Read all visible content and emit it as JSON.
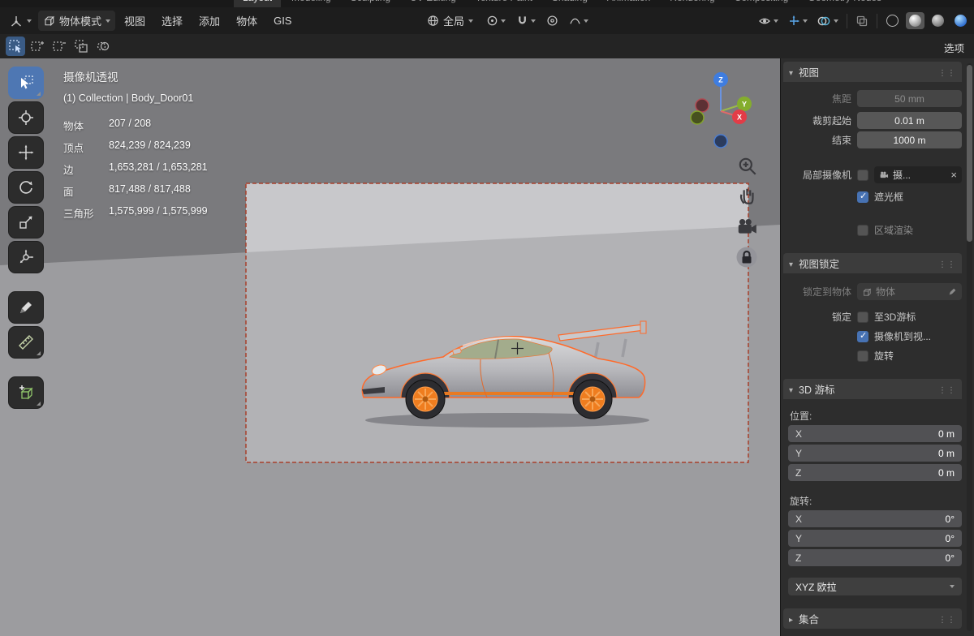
{
  "workspace_tabs": [
    "Layout",
    "Modeling",
    "Sculpting",
    "UV Editing",
    "Texture Paint",
    "Shading",
    "Animation",
    "Rendering",
    "Compositing",
    "Geometry Nodes"
  ],
  "menubar": {
    "mode_label": "物体模式",
    "menus": [
      "视图",
      "选择",
      "添加",
      "物体",
      "GIS"
    ],
    "orientation_label": "全局",
    "options_label": "选项"
  },
  "viewport": {
    "projection_label": "摄像机透视",
    "breadcrumb": "(1) Collection | Body_Door01",
    "stats": [
      {
        "label": "物体",
        "value": "207 / 208"
      },
      {
        "label": "顶点",
        "value": "824,239 / 824,239"
      },
      {
        "label": "边",
        "value": "1,653,281 / 1,653,281"
      },
      {
        "label": "面",
        "value": "817,488 / 817,488"
      },
      {
        "label": "三角形",
        "value": "1,575,999 / 1,575,999"
      }
    ],
    "gizmo": {
      "x": "X",
      "y": "Y",
      "z": "Z"
    }
  },
  "sidebar": {
    "view": {
      "title": "视图",
      "focal": {
        "label": "焦距",
        "value": "50 mm"
      },
      "clip_start": {
        "label": "裁剪起始",
        "value": "0.01 m"
      },
      "clip_end": {
        "label": "结束",
        "value": "1000 m"
      },
      "local_camera": {
        "label": "局部摄像机",
        "value": "摄..."
      },
      "passepartout_label": "遮光框",
      "render_region_label": "区域渲染"
    },
    "view_lock": {
      "title": "视图锁定",
      "lock_to_object": {
        "label": "锁定到物体",
        "value": "物体"
      },
      "lock_label": "锁定",
      "to_3d_cursor": "至3D游标",
      "camera_to_view": "摄像机到视...",
      "rotation": "旋转"
    },
    "cursor3d": {
      "title": "3D 游标",
      "location_label": "位置:",
      "rotation_label": "旋转:",
      "location": [
        {
          "axis": "X",
          "value": "0 m"
        },
        {
          "axis": "Y",
          "value": "0 m"
        },
        {
          "axis": "Z",
          "value": "0 m"
        }
      ],
      "rotation": [
        {
          "axis": "X",
          "value": "0°"
        },
        {
          "axis": "Y",
          "value": "0°"
        },
        {
          "axis": "Z",
          "value": "0°"
        }
      ],
      "rotation_mode": "XYZ 欧拉"
    },
    "collection": {
      "title": "集合"
    }
  },
  "colors": {
    "accent": "#4772b3",
    "selection_outline": "#ff6a2a"
  }
}
